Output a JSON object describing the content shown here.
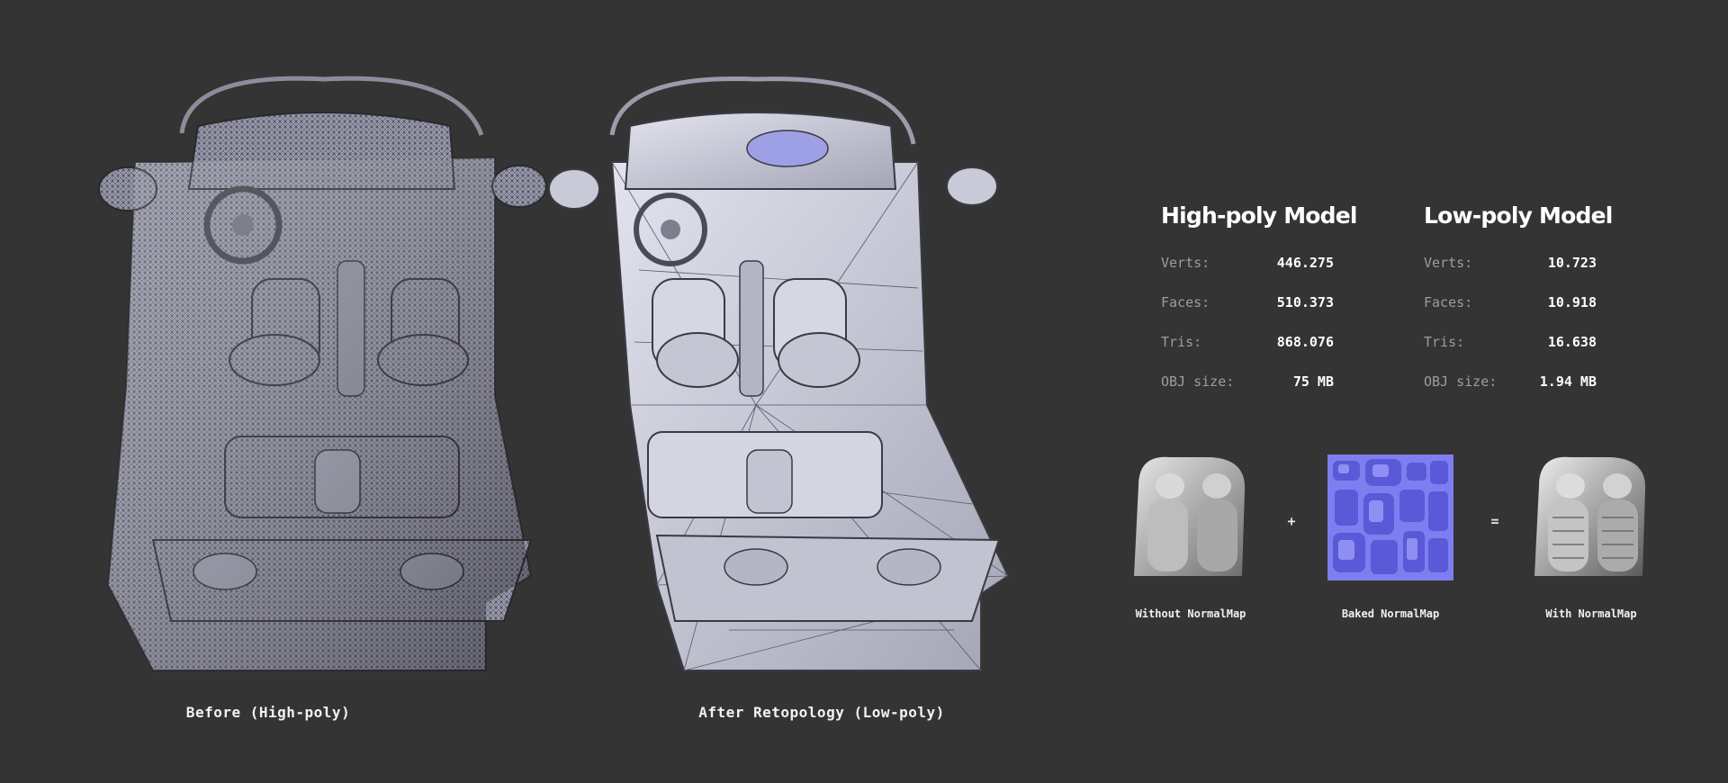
{
  "renders": {
    "high": {
      "caption": "Before (High-poly)"
    },
    "low": {
      "caption": "After Retopology (Low-poly)"
    }
  },
  "stats": {
    "high": {
      "title": "High-poly Model",
      "rows": [
        {
          "label": "Verts:",
          "value": "446.275"
        },
        {
          "label": "Faces:",
          "value": "510.373"
        },
        {
          "label": "Tris:",
          "value": "868.076"
        },
        {
          "label": "OBJ size:",
          "value": "75 MB"
        }
      ]
    },
    "low": {
      "title": "Low-poly Model",
      "rows": [
        {
          "label": "Verts:",
          "value": "10.723"
        },
        {
          "label": "Faces:",
          "value": "10.918"
        },
        {
          "label": "Tris:",
          "value": "16.638"
        },
        {
          "label": "OBJ size:",
          "value": "1.94 MB"
        }
      ]
    }
  },
  "normalmap": {
    "without_label": "Without NormalMap",
    "plus": "+",
    "baked_label": "Baked NormalMap",
    "equals": "=",
    "with_label": "With NormalMap"
  },
  "colors": {
    "background": "#343434",
    "mesh_base": "#b7b8cc",
    "normal_map": "#7e7ef0"
  }
}
